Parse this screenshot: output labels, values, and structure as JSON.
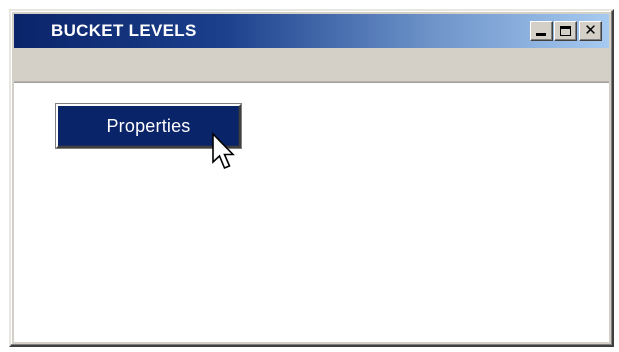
{
  "window": {
    "title": "BUCKET LEVELS"
  },
  "title_controls": {
    "minimize_icon": "minimize-icon",
    "maximize_icon": "maximize-icon",
    "close_icon": "close-icon",
    "close_glyph": "✕"
  },
  "client": {
    "properties_button_label": "Properties"
  },
  "colors": {
    "titlebar_start": "#0a246a",
    "titlebar_end": "#a6caf0",
    "button_bg": "#0a246a",
    "window_face": "#d4d0c8"
  },
  "cursor": {
    "icon": "pointer-arrow-icon"
  }
}
